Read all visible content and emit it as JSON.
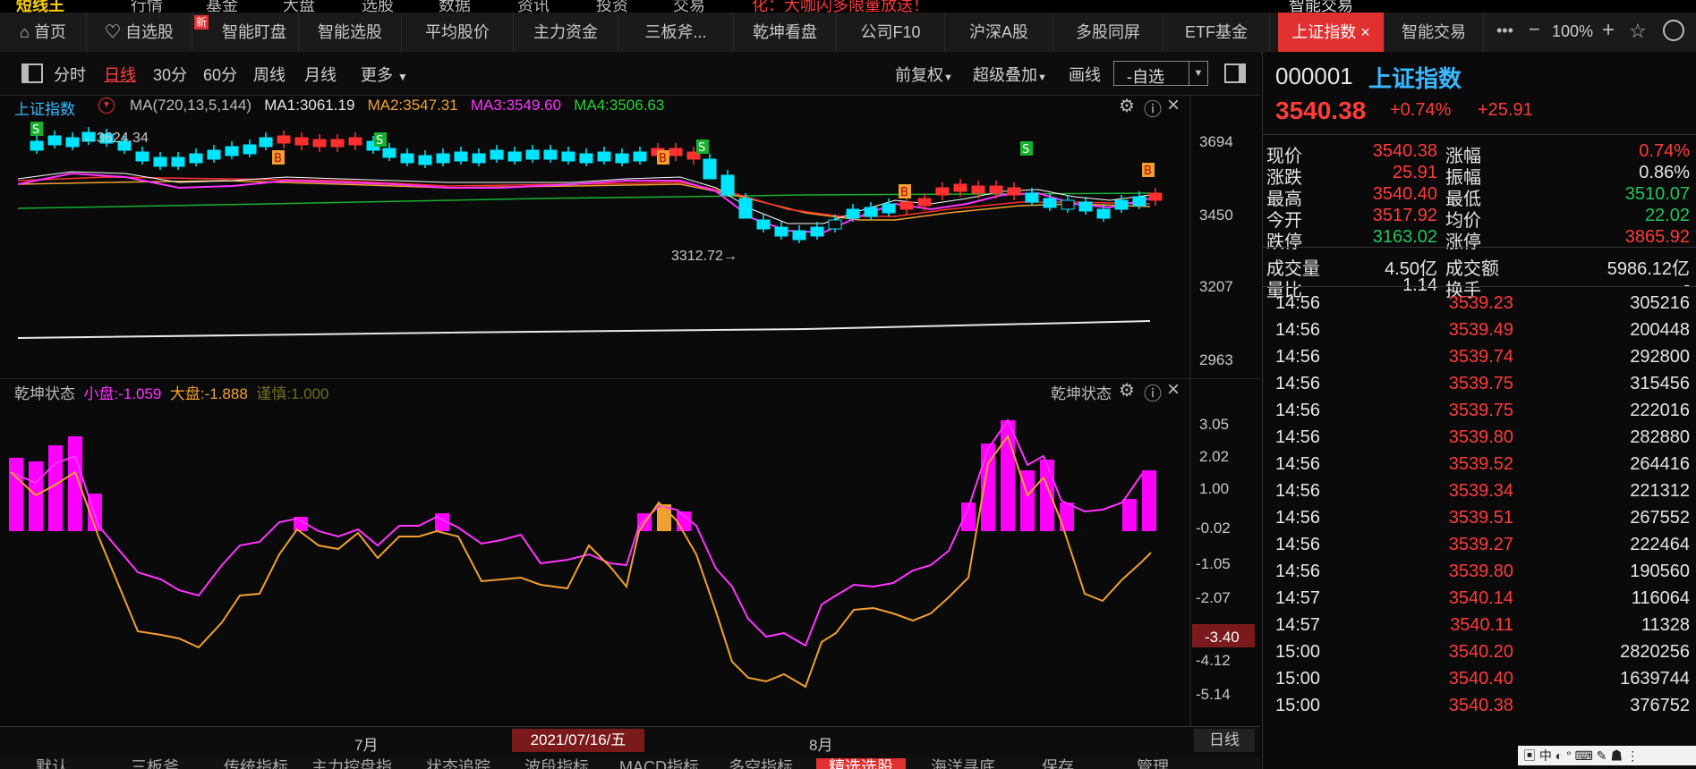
{
  "top_strip": [
    "短线王",
    "行情",
    "基金",
    "大盘",
    "选股",
    "数据",
    "资讯",
    "投资",
    "交易",
    "化：大咖闪多限量放送！",
    "智能交易"
  ],
  "tabs": [
    {
      "label": "首页",
      "icon": "home-icon"
    },
    {
      "label": "自选股",
      "icon": "heart-icon"
    },
    {
      "label": "智能盯盘",
      "badge": "新"
    },
    {
      "label": "智能选股"
    },
    {
      "label": "平均股价"
    },
    {
      "label": "主力资金"
    },
    {
      "label": "三板斧..."
    },
    {
      "label": "乾坤看盘"
    },
    {
      "label": "公司F10"
    },
    {
      "label": "沪深A股"
    },
    {
      "label": "多股同屏"
    },
    {
      "label": "ETF基金"
    },
    {
      "label": "上证指数",
      "active": true
    },
    {
      "label": "智能交易"
    }
  ],
  "window_controls": {
    "zoom": "100%"
  },
  "toolbar": {
    "periods": [
      "分时",
      "日线",
      "30分",
      "60分",
      "周线",
      "月线"
    ],
    "active_period": "日线",
    "more": "更多",
    "fq": "前复权",
    "overlay": "超级叠加",
    "draw": "画线",
    "watch": "-自选"
  },
  "main_chart": {
    "name": "上证指数",
    "ma_title": "MA(720,13,5,144)",
    "ma1": "MA1:3061.19",
    "ma2": "MA2:3547.31",
    "ma3": "MA3:3549.60",
    "ma4": "MA4:3506.63",
    "high_label": "←3624.34",
    "low_label": "3312.72→",
    "y_ticks": [
      "3694",
      "3450",
      "3207",
      "2963"
    ],
    "signals": [
      "S",
      "B",
      "S",
      "B",
      "S",
      "B",
      "B",
      "S",
      "B"
    ]
  },
  "indicator": {
    "name": "乾坤状态",
    "small": "小盘:-1.059",
    "big": "大盘:-1.888",
    "careful": "谨慎:1.000",
    "y_ticks": [
      "3.05",
      "2.02",
      "1.00",
      "-0.02",
      "-1.05",
      "-2.07",
      "-4.12",
      "-5.14"
    ],
    "current": "-3.40",
    "title_right": "乾坤状态"
  },
  "xaxis": {
    "m7": "7月",
    "date": "2021/07/16/五",
    "m8": "8月",
    "period": "日线"
  },
  "bottom_tabs": [
    "默认",
    "三板斧",
    "传统指标",
    "主力控盘指",
    "状态追踪",
    "波段指标",
    "MACD指标",
    "多空指标",
    "精选选股",
    "海洋寻底",
    "保存",
    "管理"
  ],
  "quote": {
    "code": "000001",
    "name": "上证指数",
    "price": "3540.38",
    "pct": "+0.74%",
    "chg": "+25.91",
    "rows": [
      [
        "现价",
        "3540.38",
        "涨幅",
        "0.74%"
      ],
      [
        "涨跌",
        "25.91",
        "振幅",
        "0.86%"
      ],
      [
        "最高",
        "3540.40",
        "最低",
        "3510.07"
      ],
      [
        "今开",
        "3517.92",
        "均价",
        "22.02"
      ],
      [
        "跌停",
        "3163.02",
        "涨停",
        "3865.92"
      ],
      [
        "成交量",
        "4.50亿",
        "成交额",
        "5986.12亿"
      ],
      [
        "量比",
        "1.14",
        "换手",
        "-"
      ]
    ],
    "ticks": [
      [
        "14:56",
        "3539.23",
        "305216"
      ],
      [
        "14:56",
        "3539.49",
        "200448"
      ],
      [
        "14:56",
        "3539.74",
        "292800"
      ],
      [
        "14:56",
        "3539.75",
        "315456"
      ],
      [
        "14:56",
        "3539.75",
        "222016"
      ],
      [
        "14:56",
        "3539.80",
        "282880"
      ],
      [
        "14:56",
        "3539.52",
        "264416"
      ],
      [
        "14:56",
        "3539.34",
        "221312"
      ],
      [
        "14:56",
        "3539.51",
        "267552"
      ],
      [
        "14:56",
        "3539.27",
        "222464"
      ],
      [
        "14:56",
        "3539.80",
        "190560"
      ],
      [
        "14:57",
        "3540.14",
        "116064"
      ],
      [
        "14:57",
        "3540.11",
        "11328"
      ],
      [
        "15:00",
        "3540.20",
        "2820256"
      ],
      [
        "15:00",
        "3540.40",
        "1639744"
      ],
      [
        "15:00",
        "3540.38",
        "376752"
      ]
    ]
  },
  "ime": "中"
}
